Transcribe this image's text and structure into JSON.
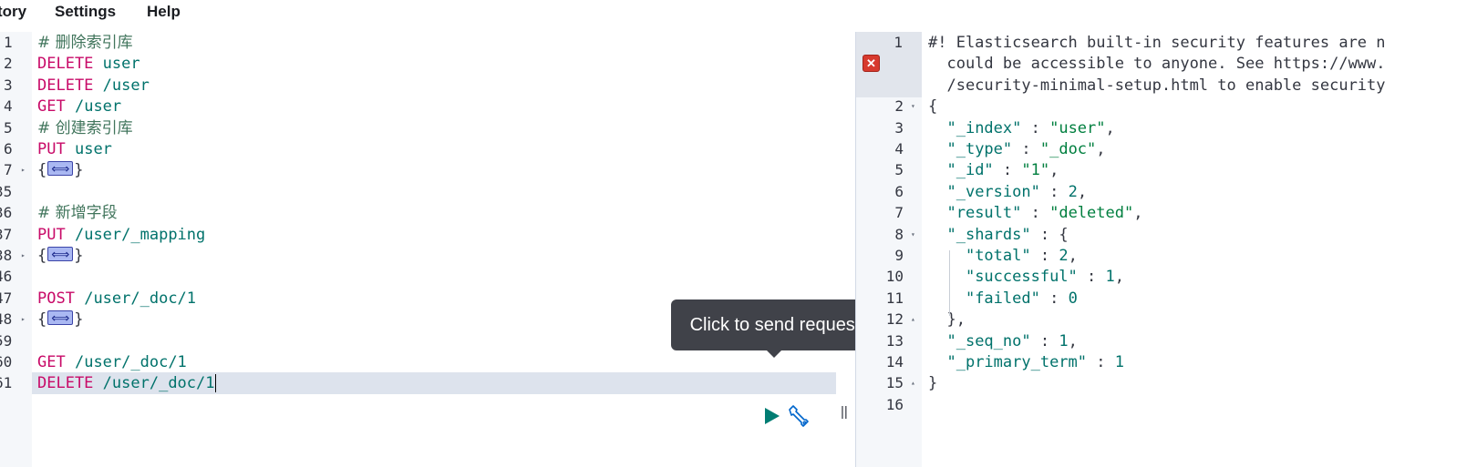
{
  "menu": {
    "history": "tory",
    "settings": "Settings",
    "help": "Help"
  },
  "tooltip": {
    "text": "Click to send request"
  },
  "resizer_glyph": "||",
  "editor": {
    "lines": [
      {
        "num": "1",
        "fold": "",
        "tokens": [
          {
            "t": "comment",
            "v": "# 删除索引库"
          }
        ]
      },
      {
        "num": "2",
        "fold": "",
        "tokens": [
          {
            "t": "method",
            "v": "DELETE"
          },
          {
            "t": "plain",
            "v": " "
          },
          {
            "t": "path",
            "v": "user"
          }
        ]
      },
      {
        "num": "3",
        "fold": "",
        "tokens": [
          {
            "t": "method",
            "v": "DELETE"
          },
          {
            "t": "plain",
            "v": " "
          },
          {
            "t": "path",
            "v": "/user"
          }
        ]
      },
      {
        "num": "4",
        "fold": "",
        "tokens": [
          {
            "t": "method",
            "v": "GET"
          },
          {
            "t": "plain",
            "v": " "
          },
          {
            "t": "path",
            "v": "/user"
          }
        ]
      },
      {
        "num": "5",
        "fold": "",
        "tokens": [
          {
            "t": "comment",
            "v": "# 创建索引库"
          }
        ]
      },
      {
        "num": "6",
        "fold": "",
        "tokens": [
          {
            "t": "method",
            "v": "PUT"
          },
          {
            "t": "plain",
            "v": " "
          },
          {
            "t": "path",
            "v": "user"
          }
        ]
      },
      {
        "num": "7",
        "fold": "▸",
        "tokens": [
          {
            "t": "plain",
            "v": "{"
          },
          {
            "t": "foldbox",
            "v": ""
          },
          {
            "t": "plain",
            "v": "}"
          }
        ]
      },
      {
        "num": "35",
        "fold": "",
        "tokens": []
      },
      {
        "num": "36",
        "fold": "",
        "tokens": [
          {
            "t": "comment",
            "v": "# 新增字段"
          }
        ]
      },
      {
        "num": "37",
        "fold": "",
        "tokens": [
          {
            "t": "method",
            "v": "PUT"
          },
          {
            "t": "plain",
            "v": " "
          },
          {
            "t": "path",
            "v": "/user/_mapping"
          }
        ]
      },
      {
        "num": "38",
        "fold": "▸",
        "tokens": [
          {
            "t": "plain",
            "v": "{"
          },
          {
            "t": "foldbox",
            "v": ""
          },
          {
            "t": "plain",
            "v": "}"
          }
        ]
      },
      {
        "num": "46",
        "fold": "",
        "tokens": []
      },
      {
        "num": "47",
        "fold": "",
        "tokens": [
          {
            "t": "method",
            "v": "POST"
          },
          {
            "t": "plain",
            "v": " "
          },
          {
            "t": "path",
            "v": "/user/_doc/1"
          }
        ]
      },
      {
        "num": "48",
        "fold": "▸",
        "tokens": [
          {
            "t": "plain",
            "v": "{"
          },
          {
            "t": "foldbox",
            "v": ""
          },
          {
            "t": "plain",
            "v": "}"
          }
        ]
      },
      {
        "num": "59",
        "fold": "",
        "tokens": []
      },
      {
        "num": "60",
        "fold": "",
        "tokens": [
          {
            "t": "method",
            "v": "GET"
          },
          {
            "t": "plain",
            "v": " "
          },
          {
            "t": "path",
            "v": "/user/_doc/1"
          }
        ]
      },
      {
        "num": "61",
        "fold": "",
        "tokens": [
          {
            "t": "method",
            "v": "DELETE"
          },
          {
            "t": "plain",
            "v": " "
          },
          {
            "t": "path",
            "v": "/user/_doc/1"
          },
          {
            "t": "cursor",
            "v": ""
          }
        ]
      }
    ]
  },
  "output": {
    "warning_lines": [
      "#! Elasticsearch built-in security features are n",
      "  could be accessible to anyone. See https://www.",
      "  /security-minimal-setup.html to enable security"
    ],
    "lines": [
      {
        "num": "2",
        "fold": "▾",
        "tokens": [
          {
            "t": "punc",
            "v": "{"
          }
        ]
      },
      {
        "num": "3",
        "fold": "",
        "tokens": [
          {
            "t": "punc",
            "v": "  "
          },
          {
            "t": "key",
            "v": "\"_index\""
          },
          {
            "t": "punc",
            "v": " : "
          },
          {
            "t": "str",
            "v": "\"user\""
          },
          {
            "t": "punc",
            "v": ","
          }
        ]
      },
      {
        "num": "4",
        "fold": "",
        "tokens": [
          {
            "t": "punc",
            "v": "  "
          },
          {
            "t": "key",
            "v": "\"_type\""
          },
          {
            "t": "punc",
            "v": " : "
          },
          {
            "t": "str",
            "v": "\"_doc\""
          },
          {
            "t": "punc",
            "v": ","
          }
        ]
      },
      {
        "num": "5",
        "fold": "",
        "tokens": [
          {
            "t": "punc",
            "v": "  "
          },
          {
            "t": "key",
            "v": "\"_id\""
          },
          {
            "t": "punc",
            "v": " : "
          },
          {
            "t": "str",
            "v": "\"1\""
          },
          {
            "t": "punc",
            "v": ","
          }
        ]
      },
      {
        "num": "6",
        "fold": "",
        "tokens": [
          {
            "t": "punc",
            "v": "  "
          },
          {
            "t": "key",
            "v": "\"_version\""
          },
          {
            "t": "punc",
            "v": " : "
          },
          {
            "t": "num",
            "v": "2"
          },
          {
            "t": "punc",
            "v": ","
          }
        ]
      },
      {
        "num": "7",
        "fold": "",
        "tokens": [
          {
            "t": "punc",
            "v": "  "
          },
          {
            "t": "key",
            "v": "\"result\""
          },
          {
            "t": "punc",
            "v": " : "
          },
          {
            "t": "str",
            "v": "\"deleted\""
          },
          {
            "t": "punc",
            "v": ","
          }
        ]
      },
      {
        "num": "8",
        "fold": "▾",
        "tokens": [
          {
            "t": "punc",
            "v": "  "
          },
          {
            "t": "key",
            "v": "\"_shards\""
          },
          {
            "t": "punc",
            "v": " : {"
          }
        ]
      },
      {
        "num": "9",
        "fold": "",
        "tokens": [
          {
            "t": "punc",
            "v": "    "
          },
          {
            "t": "key",
            "v": "\"total\""
          },
          {
            "t": "punc",
            "v": " : "
          },
          {
            "t": "num",
            "v": "2"
          },
          {
            "t": "punc",
            "v": ","
          }
        ]
      },
      {
        "num": "10",
        "fold": "",
        "tokens": [
          {
            "t": "punc",
            "v": "    "
          },
          {
            "t": "key",
            "v": "\"successful\""
          },
          {
            "t": "punc",
            "v": " : "
          },
          {
            "t": "num",
            "v": "1"
          },
          {
            "t": "punc",
            "v": ","
          }
        ]
      },
      {
        "num": "11",
        "fold": "",
        "tokens": [
          {
            "t": "punc",
            "v": "    "
          },
          {
            "t": "key",
            "v": "\"failed\""
          },
          {
            "t": "punc",
            "v": " : "
          },
          {
            "t": "num",
            "v": "0"
          }
        ]
      },
      {
        "num": "12",
        "fold": "▴",
        "tokens": [
          {
            "t": "punc",
            "v": "  },"
          }
        ]
      },
      {
        "num": "13",
        "fold": "",
        "tokens": [
          {
            "t": "punc",
            "v": "  "
          },
          {
            "t": "key",
            "v": "\"_seq_no\""
          },
          {
            "t": "punc",
            "v": " : "
          },
          {
            "t": "num",
            "v": "1"
          },
          {
            "t": "punc",
            "v": ","
          }
        ]
      },
      {
        "num": "14",
        "fold": "",
        "tokens": [
          {
            "t": "punc",
            "v": "  "
          },
          {
            "t": "key",
            "v": "\"_primary_term\""
          },
          {
            "t": "punc",
            "v": " : "
          },
          {
            "t": "num",
            "v": "1"
          }
        ]
      },
      {
        "num": "15",
        "fold": "▴",
        "tokens": [
          {
            "t": "punc",
            "v": "}"
          }
        ]
      },
      {
        "num": "16",
        "fold": "",
        "tokens": []
      }
    ],
    "first_line_num": "1"
  },
  "colors": {
    "method": "#c80a68",
    "path": "#00726b",
    "comment": "#41755c",
    "tooltip_bg": "#404249",
    "error": "#d73a2e",
    "active_line": "#dde3ed"
  },
  "icons": {
    "play": "play-icon",
    "wrench": "wrench-icon",
    "error": "error-icon",
    "fold": "fold-icon"
  }
}
